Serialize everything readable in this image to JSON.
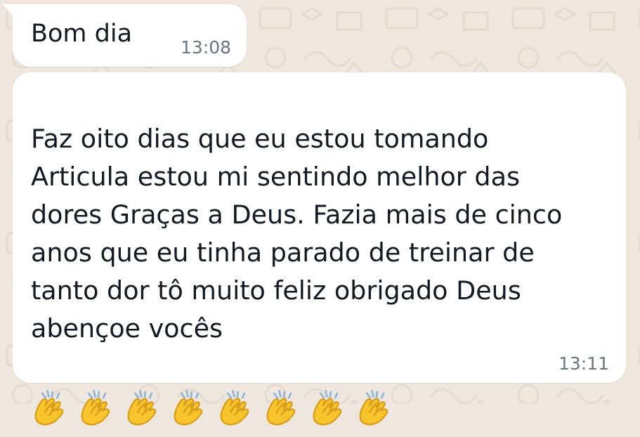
{
  "conversation": {
    "messages": [
      {
        "text": "Bom dia",
        "time": "13:08"
      },
      {
        "text": "Faz oito dias que eu estou tomando\nArticula estou mi sentindo melhor das\ndores Graças a Deus. Fazia mais de cinco\nanos que eu tinha parado de treinar de\ntanto dor tô muito feliz obrigado Deus\nabençoe vocês",
        "emoji_name": "clapping-hands-emoji",
        "emoji_count": 8,
        "time": "13:11"
      }
    ]
  },
  "colors": {
    "background": "#efe7dd",
    "bubble": "#ffffff",
    "text": "#111b21",
    "timestamp": "#667781",
    "emoji": "#f7c52b"
  }
}
